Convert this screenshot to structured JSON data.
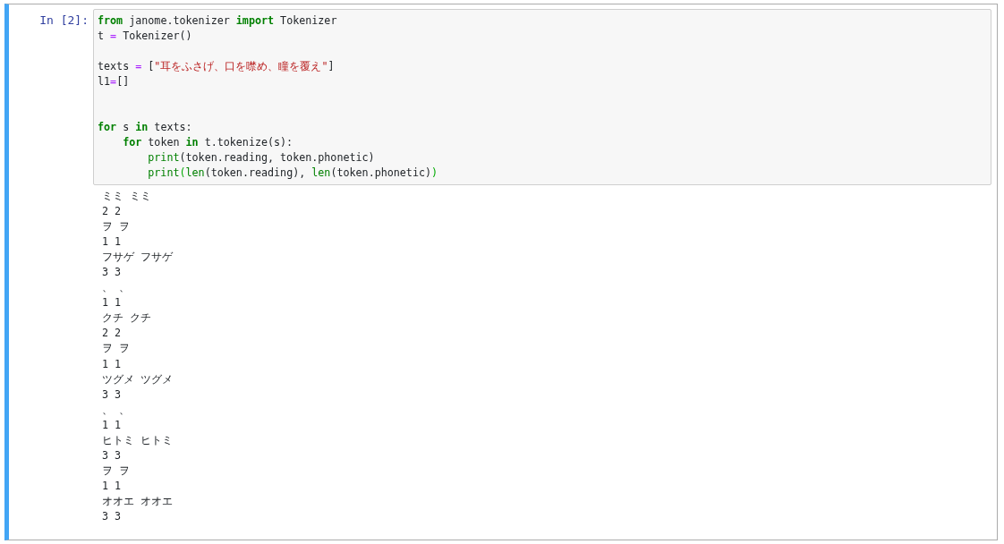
{
  "cell": {
    "prompt": "In [2]:",
    "selected": true,
    "code": [
      {
        "kind": "code",
        "tokens": [
          {
            "text": "from",
            "kind": "kw"
          },
          {
            "text": " janome.tokenizer ",
            "kind": "plain"
          },
          {
            "text": "import",
            "kind": "kw"
          },
          {
            "text": " Tokenizer",
            "kind": "plain"
          }
        ]
      },
      {
        "kind": "code",
        "tokens": [
          {
            "text": "t ",
            "kind": "plain"
          },
          {
            "text": "=",
            "kind": "op"
          },
          {
            "text": " Tokenizer()",
            "kind": "plain"
          }
        ]
      },
      {
        "kind": "blank"
      },
      {
        "kind": "code",
        "tokens": [
          {
            "text": "texts ",
            "kind": "plain"
          },
          {
            "text": "=",
            "kind": "op"
          },
          {
            "text": " [",
            "kind": "plain"
          },
          {
            "text": "\"耳をふさげ、口を噤め、瞳を覆え\"",
            "kind": "str"
          },
          {
            "text": "]",
            "kind": "plain"
          }
        ]
      },
      {
        "kind": "code",
        "tokens": [
          {
            "text": "l1",
            "kind": "plain"
          },
          {
            "text": "=",
            "kind": "op"
          },
          {
            "text": "[]",
            "kind": "plain"
          }
        ]
      },
      {
        "kind": "blank"
      },
      {
        "kind": "blank"
      },
      {
        "kind": "code",
        "tokens": [
          {
            "text": "for",
            "kind": "kw"
          },
          {
            "text": " s ",
            "kind": "plain"
          },
          {
            "text": "in",
            "kind": "kw"
          },
          {
            "text": " texts:",
            "kind": "plain"
          }
        ]
      },
      {
        "kind": "code",
        "tokens": [
          {
            "text": "    for",
            "kind": "kw"
          },
          {
            "text": " token ",
            "kind": "plain"
          },
          {
            "text": "in",
            "kind": "kw"
          },
          {
            "text": " t.tokenize(s):",
            "kind": "plain"
          }
        ]
      },
      {
        "kind": "code",
        "tokens": [
          {
            "text": "        print",
            "kind": "builtin"
          },
          {
            "text": "(token.reading, token.phonetic)",
            "kind": "plain"
          }
        ]
      },
      {
        "kind": "code",
        "tokens": [
          {
            "text": "        print",
            "kind": "builtin"
          },
          {
            "text": "(",
            "kind": "match"
          },
          {
            "text": "len",
            "kind": "builtin"
          },
          {
            "text": "(token.reading), ",
            "kind": "plain"
          },
          {
            "text": "len",
            "kind": "builtin"
          },
          {
            "text": "(token.phonetic)",
            "kind": "plain"
          },
          {
            "text": ")",
            "kind": "match"
          }
        ]
      }
    ],
    "output": [
      "ミミ ミミ",
      "2 2",
      "ヲ ヲ",
      "1 1",
      "フサゲ フサゲ",
      "3 3",
      "、 、",
      "1 1",
      "クチ クチ",
      "2 2",
      "ヲ ヲ",
      "1 1",
      "ツグメ ツグメ",
      "3 3",
      "、 、",
      "1 1",
      "ヒトミ ヒトミ",
      "3 3",
      "ヲ ヲ",
      "1 1",
      "オオエ オオエ",
      "3 3"
    ]
  }
}
